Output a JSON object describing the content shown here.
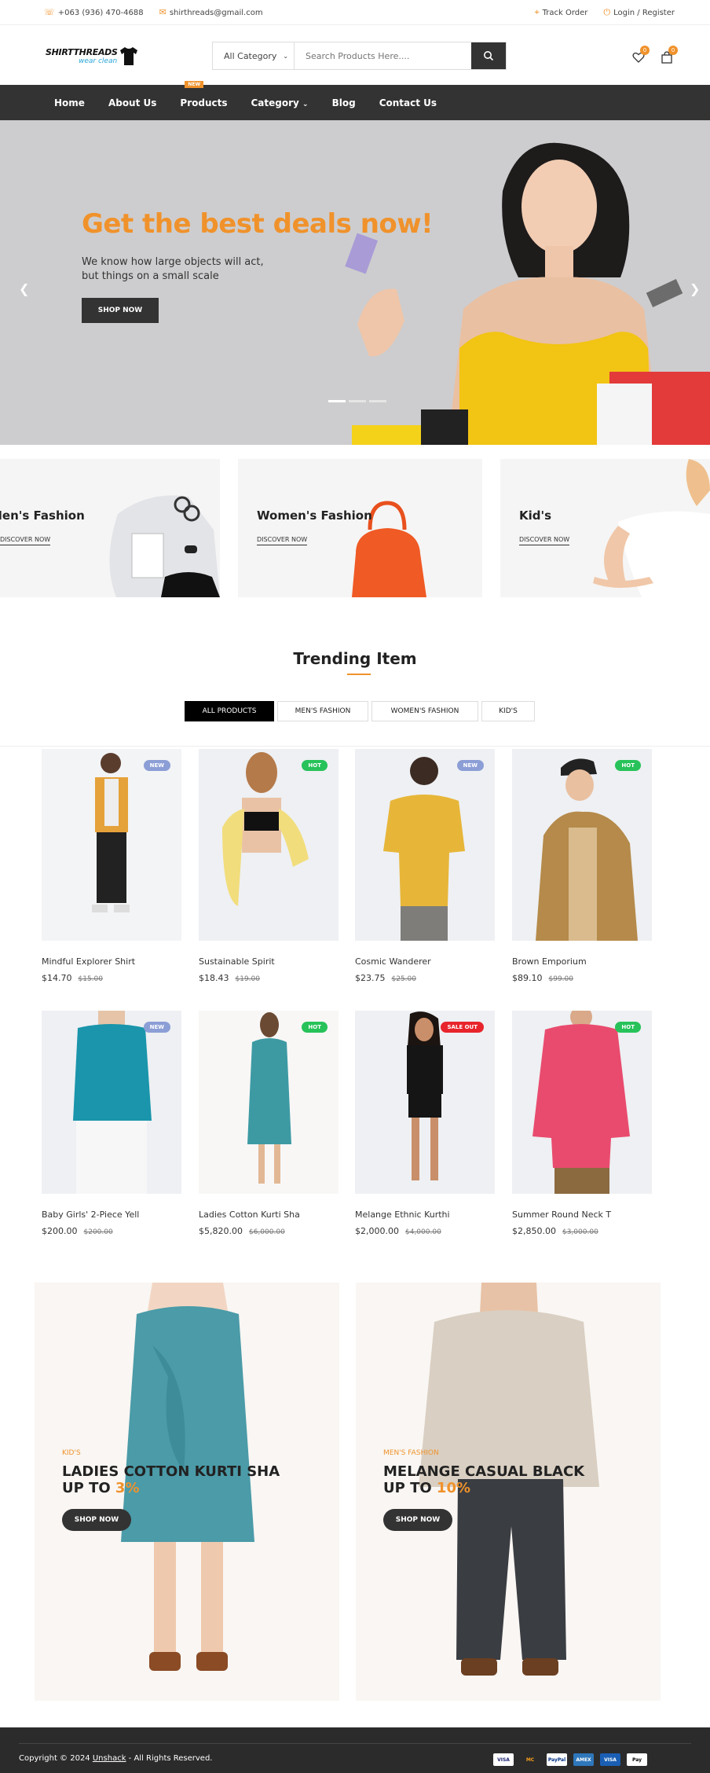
{
  "topbar": {
    "phone": "+063 (936) 470-4688",
    "email": "shirthreads@gmail.com",
    "track": "Track Order",
    "login": "Login / Register"
  },
  "header": {
    "logo_name": "SHIRTTHREADS",
    "logo_tag": "wear clean",
    "category_label": "All Category",
    "search_placeholder": "Search Products Here....",
    "wishlist_count": "0",
    "cart_count": "0"
  },
  "nav": {
    "items": [
      "Home",
      "About Us",
      "Products",
      "Category",
      "Blog",
      "Contact Us"
    ],
    "products_badge": "NEW"
  },
  "hero": {
    "title": "Get the best deals now!",
    "subtitle": "We know how large objects will act, but things on a small scale",
    "button": "SHOP NOW"
  },
  "categories": [
    {
      "title": "Men's Fashion",
      "link": "DISCOVER NOW"
    },
    {
      "title": "Women's Fashion",
      "link": "DISCOVER NOW"
    },
    {
      "title": "Kid's",
      "link": "DISCOVER NOW"
    }
  ],
  "trending": {
    "title": "Trending Item",
    "tabs": [
      "ALL PRODUCTS",
      "MEN'S FASHION",
      "WOMEN'S FASHION",
      "KID'S"
    ]
  },
  "products": [
    {
      "name": "Mindful Explorer Shirt",
      "price": "$14.70",
      "old": "$15.00",
      "badge": "NEW"
    },
    {
      "name": "Sustainable Spirit",
      "price": "$18.43",
      "old": "$19.00",
      "badge": "HOT"
    },
    {
      "name": "Cosmic Wanderer",
      "price": "$23.75",
      "old": "$25.00",
      "badge": "NEW"
    },
    {
      "name": "Brown Emporium",
      "price": "$89.10",
      "old": "$99.00",
      "badge": "HOT"
    },
    {
      "name": "Baby Girls' 2-Piece Yell",
      "price": "$200.00",
      "old": "$200.00",
      "badge": "NEW"
    },
    {
      "name": "Ladies Cotton Kurti Sha",
      "price": "$5,820.00",
      "old": "$6,000.00",
      "badge": "HOT"
    },
    {
      "name": "Melange Ethnic Kurthi",
      "price": "$2,000.00",
      "old": "$4,000.00",
      "badge": "SALE OUT"
    },
    {
      "name": "Summer Round Neck T",
      "price": "$2,850.00",
      "old": "$3,000.00",
      "badge": "HOT"
    }
  ],
  "banners": [
    {
      "kicker": "KID'S",
      "line1": "LADIES COTTON KURTI SHA",
      "line2_pre": "UP TO ",
      "line2_pct": "3%",
      "button": "SHOP NOW"
    },
    {
      "kicker": "MEN'S FASHION",
      "line1": "MELANGE CASUAL BLACK",
      "line2_pre": "UP TO ",
      "line2_pct": "10%",
      "button": "SHOP NOW"
    }
  ],
  "footer": {
    "copy_pre": "Copyright © 2024 ",
    "copy_link": "Unshack",
    "copy_post": " - All Rights Reserved.",
    "payments": [
      "VISA",
      "MC",
      "PayPal",
      "AMEX",
      "VISA",
      "Pay"
    ]
  },
  "colors": {
    "accent": "#f0922b",
    "dark": "#333333",
    "badge_new": "#8c9ed6",
    "badge_hot": "#27c25a",
    "badge_sale": "#e8252c"
  }
}
